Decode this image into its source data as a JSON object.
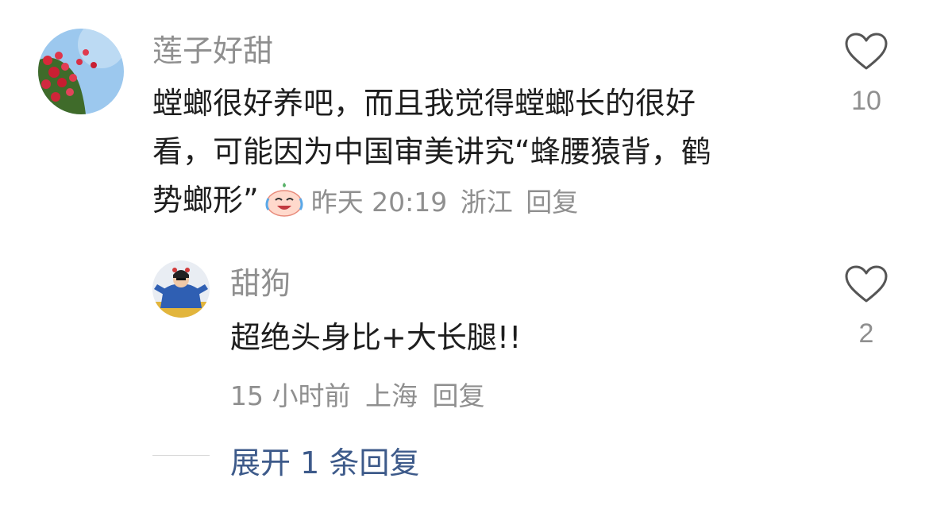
{
  "comments": [
    {
      "username": "莲子好甜",
      "text_lines": [
        "螳螂很好养吧，而且我觉得螳螂长的很好",
        "看，可能因为中国审美讲究“蜂腰猿背，鹤",
        "势螂形”"
      ],
      "emoji": "laughing-crying-emoji",
      "time": "昨天 20:19",
      "location": "浙江",
      "reply_label": "回复",
      "likes": "10"
    },
    {
      "username": "甜狗",
      "text": "超绝头身比+大长腿!!",
      "time": "15 小时前",
      "location": "上海",
      "reply_label": "回复",
      "likes": "2"
    }
  ],
  "expand_replies": "展开 1 条回复",
  "colors": {
    "meta": "#8f8f8f",
    "link": "#3d5a8a",
    "text": "#1e1e1e"
  },
  "icons": {
    "like": "heart-outline-icon"
  }
}
